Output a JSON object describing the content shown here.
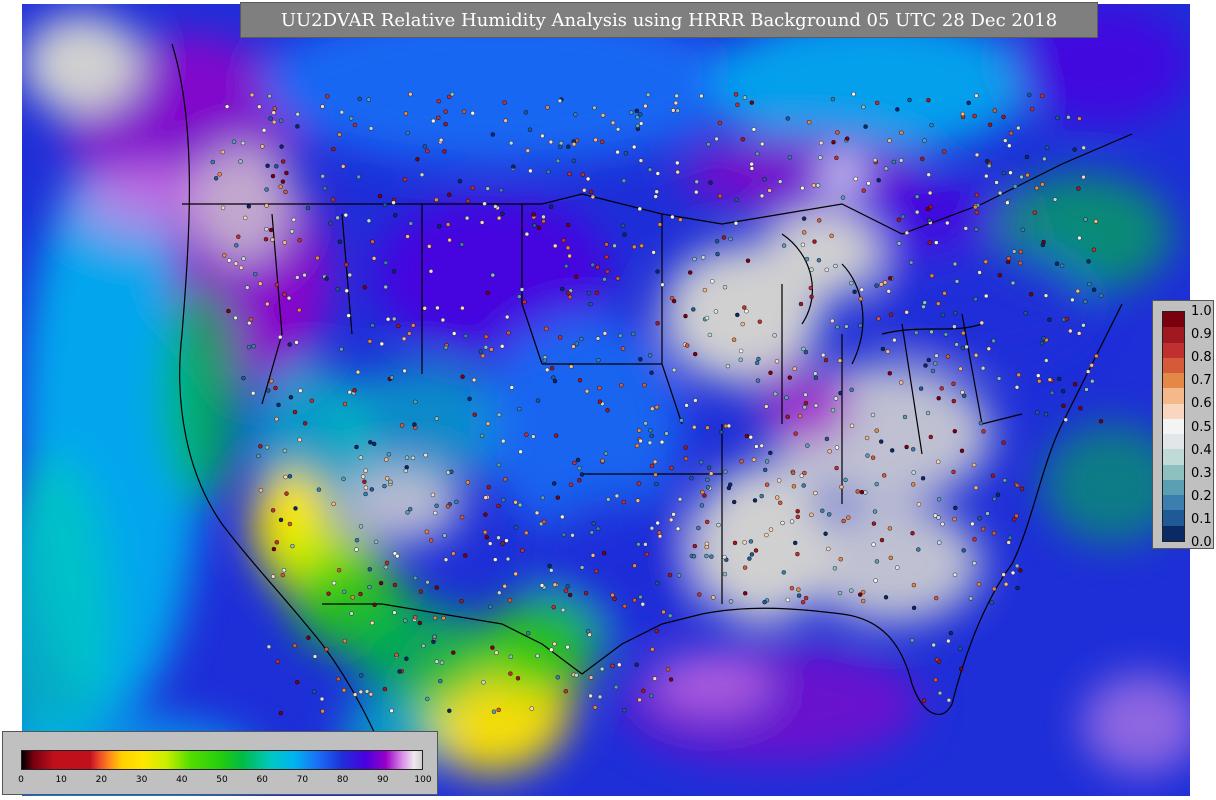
{
  "title": "UU2DVAR Relative Humidity Analysis using HRRR Background 05 UTC 28 Dec 2018",
  "rh_legend": {
    "ticks": [
      "0",
      "10",
      "20",
      "30",
      "40",
      "50",
      "60",
      "70",
      "80",
      "90",
      "100"
    ],
    "stops": [
      {
        "value": 0,
        "color": "#000000"
      },
      {
        "value": 3,
        "color": "#7a0010"
      },
      {
        "value": 8,
        "color": "#c0101c"
      },
      {
        "value": 17,
        "color": "#c0101c"
      },
      {
        "value": 19,
        "color": "#e8402a"
      },
      {
        "value": 22,
        "color": "#ff8c1a"
      },
      {
        "value": 25,
        "color": "#ffd000"
      },
      {
        "value": 30,
        "color": "#ffe600"
      },
      {
        "value": 36,
        "color": "#ccee00"
      },
      {
        "value": 42,
        "color": "#55dd00"
      },
      {
        "value": 50,
        "color": "#22cc10"
      },
      {
        "value": 55,
        "color": "#00bb44"
      },
      {
        "value": 62,
        "color": "#00c8c0"
      },
      {
        "value": 68,
        "color": "#00b4f0"
      },
      {
        "value": 74,
        "color": "#1a6ef5"
      },
      {
        "value": 80,
        "color": "#1e2fd8"
      },
      {
        "value": 86,
        "color": "#4a00e0"
      },
      {
        "value": 91,
        "color": "#9a00c8"
      },
      {
        "value": 95,
        "color": "#d88ce8"
      },
      {
        "value": 98,
        "color": "#f0e8f0"
      },
      {
        "value": 100,
        "color": "#d0d0d0"
      }
    ]
  },
  "obs_legend": {
    "ticks": [
      "0.0",
      "0.1",
      "0.2",
      "0.3",
      "0.4",
      "0.5",
      "0.6",
      "0.7",
      "0.8",
      "0.9",
      "1.0"
    ],
    "colors": [
      "#0a2a66",
      "#1f5a96",
      "#3b7fae",
      "#5a9fb4",
      "#8fc0c0",
      "#c0dad8",
      "#e2e6e8",
      "#f4f4f4",
      "#f8d6c0",
      "#f4b88a",
      "#e48848",
      "#d45a3a",
      "#c03030",
      "#a01820",
      "#7a0010"
    ]
  },
  "colors": {
    "ocean": "#1e2fd8",
    "land_moist": "#4a00e0",
    "dry_high": "#d0d0d0",
    "title_bg": "#7f7f7f",
    "legend_bg": "#c0c0c0"
  }
}
